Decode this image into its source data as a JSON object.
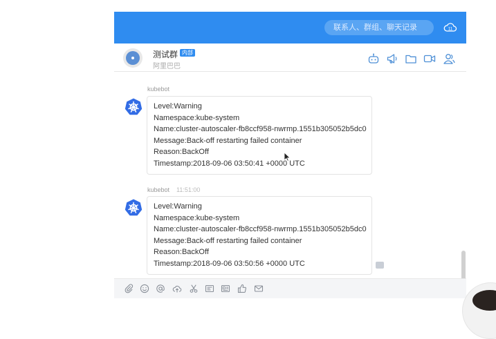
{
  "search": {
    "placeholder": "联系人、群组、聊天记录"
  },
  "group": {
    "name": "测试群",
    "badge": "内部",
    "org": "阿里巴巴"
  },
  "messages": [
    {
      "sender": "kubebot",
      "time": "",
      "lines": [
        "Level:Warning",
        "Namespace:kube-system",
        "Name:cluster-autoscaler-fb8ccf958-nwrmp.1551b305052b5dc0",
        "Message:Back-off restarting failed container",
        "Reason:BackOff",
        "Timestamp:2018-09-06 03:50:41 +0000 UTC"
      ]
    },
    {
      "sender": "kubebot",
      "time": "11:51:00",
      "lines": [
        "Level:Warning",
        "Namespace:kube-system",
        "Name:cluster-autoscaler-fb8ccf958-nwrmp.1551b305052b5dc0",
        "Message:Back-off restarting failed container",
        "Reason:BackOff",
        "Timestamp:2018-09-06 03:50:56 +0000 UTC"
      ]
    }
  ],
  "header_icons": [
    "robot-icon",
    "megaphone-icon",
    "folder-icon",
    "video-icon",
    "members-icon"
  ],
  "toolbar_icons": [
    "attachment-icon",
    "emoji-icon",
    "mention-icon",
    "cloud-upload-icon",
    "scissors-icon",
    "screenshot-icon",
    "card-icon",
    "thumbs-up-icon",
    "mail-icon"
  ],
  "colors": {
    "accent": "#2f8cf0",
    "k8s": "#326ce5"
  }
}
